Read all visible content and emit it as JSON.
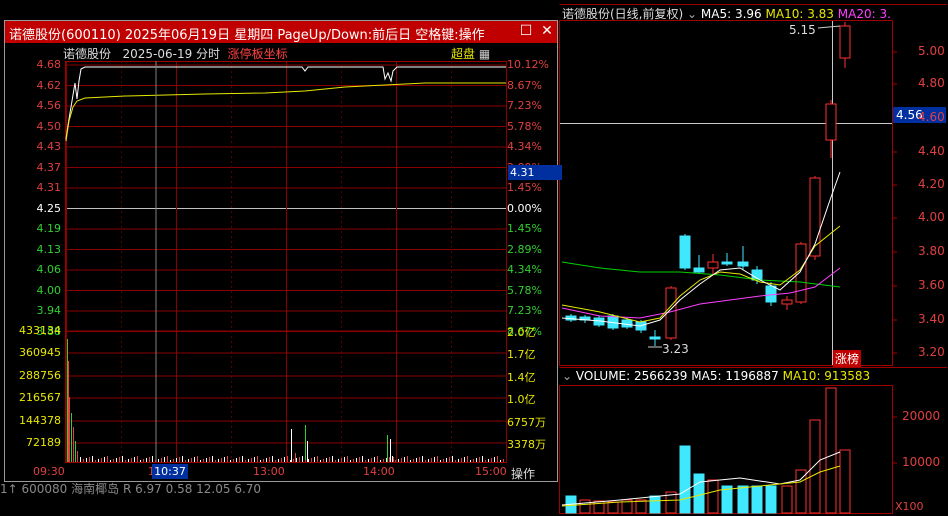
{
  "kline": {
    "header": {
      "name": "诺德股份(日线,前复权)",
      "ma5_label": "MA5: 3.96",
      "ma10_label": "MA10: 3.83",
      "ma20_label": "MA20: 3."
    },
    "high_label": "5.15",
    "low_label": "3.23",
    "cursor_price": "4.56",
    "y_ticks": [
      "5.00",
      "4.80",
      "4.60",
      "4.40",
      "4.20",
      "4.00",
      "3.80",
      "3.60",
      "3.40",
      "3.20"
    ],
    "zhangbang_label": "涨榜",
    "colors": {
      "up": "#ff3030",
      "down": "#40e8ff",
      "ma5": "#ffffff",
      "ma10": "#e8e800",
      "ma20": "#ff40ff",
      "ma60": "#00d000"
    }
  },
  "volume": {
    "header": {
      "label": "VOLUME: 2566239",
      "ma5_label": "MA5: 1196887",
      "ma10_label": "MA10: 913583"
    },
    "y_ticks": [
      "20000",
      "10000"
    ],
    "unit": "X100"
  },
  "popup": {
    "title": "诺德股份(600110)  2025年06月19日  星期四  PageUp/Down:前后日  空格键:操作",
    "close_symbol": "✕",
    "restore_symbol": "☐",
    "stock_name": "诺德股份",
    "date_label": "2025-06-19 分时",
    "mode_label": "涨停板坐标",
    "chaopan_label": "超盘",
    "price_ticks": [
      "4.68",
      "4.62",
      "4.56",
      "4.50",
      "4.43",
      "4.37",
      "4.31",
      "4.25",
      "4.19",
      "4.13",
      "4.06",
      "4.00",
      "3.94",
      "3.88"
    ],
    "pct_ticks": [
      "10.12%",
      "8.67%",
      "7.23%",
      "5.78%",
      "4.34%",
      "2.89%",
      "1.45%",
      "0.00%",
      "1.45%",
      "2.89%",
      "4.34%",
      "5.78%",
      "7.23%",
      "8.67%"
    ],
    "vol_ticks_left": [
      "433134",
      "360945",
      "288756",
      "216567",
      "144378",
      "72189"
    ],
    "vol_ticks_right": [
      "2.0亿",
      "1.7亿",
      "1.4亿",
      "1.0亿",
      "6757万",
      "3378万"
    ],
    "time_labels": [
      "09:30",
      "10:30",
      "13:00",
      "14:00",
      "15:00"
    ],
    "cursor_time": "10:37",
    "cursor_price": "4.31",
    "operate_label": "操作"
  },
  "bottom_row": {
    "text": "1↑  600080  海南椰岛  R   6.97   0.58   12.05   6.70"
  }
}
